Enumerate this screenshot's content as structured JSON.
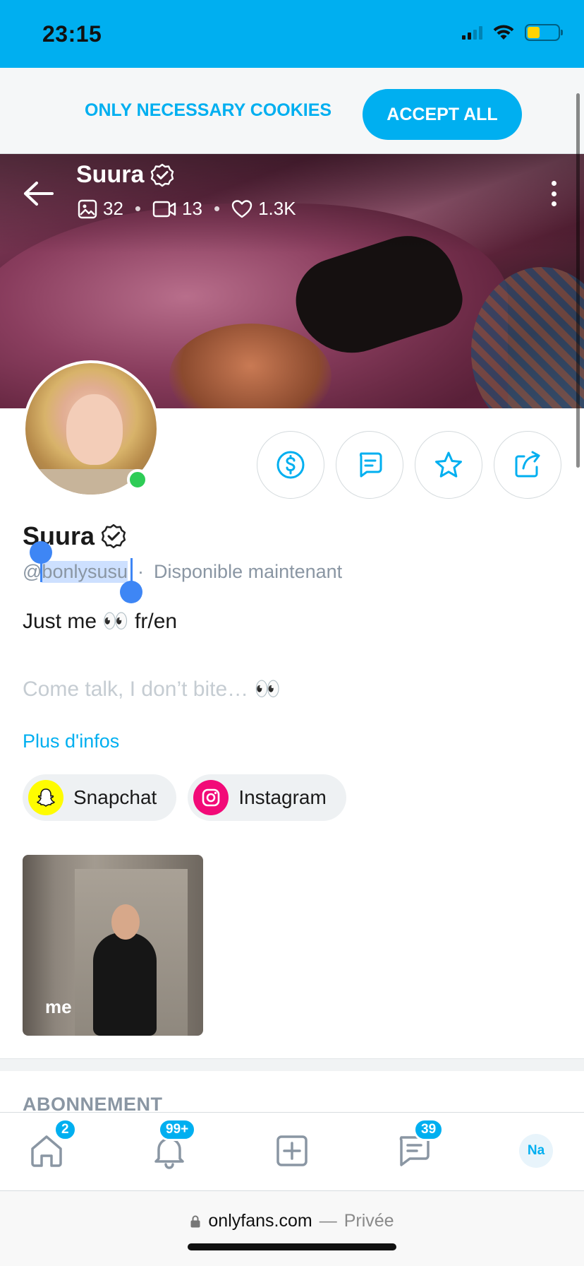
{
  "status_bar": {
    "time": "23:15"
  },
  "cookie_banner": {
    "necessary_label": "ONLY NECESSARY COOKIES",
    "accept_label": "ACCEPT ALL"
  },
  "header": {
    "name": "Suura",
    "photos_count": "32",
    "videos_count": "13",
    "likes_count": "1.3K"
  },
  "profile": {
    "name": "Suura",
    "handle_prefix": "@",
    "handle_selected": "bonlysusu",
    "separator": "·",
    "availability": "Disponible maintenant",
    "bio_line1": "Just me 👀 fr/en",
    "bio_line2": "Come talk, I don’t bite… 👀",
    "more_info": "Plus d'infos",
    "status_color": "#2ecc56"
  },
  "social_links": [
    {
      "label": "Snapchat",
      "icon": "snapchat-icon",
      "color": "#fffc00"
    },
    {
      "label": "Instagram",
      "icon": "instagram-icon",
      "color": "#f20a78"
    }
  ],
  "highlights": [
    {
      "label": "me"
    }
  ],
  "section": {
    "subscription_title": "ABONNEMENT"
  },
  "bottom_nav": {
    "home_badge": "2",
    "notifications_badge": "99+",
    "messages_badge": "39",
    "avatar_initials": "Na"
  },
  "browser": {
    "domain": "onlyfans.com",
    "dash": "—",
    "mode": "Privée"
  },
  "colors": {
    "accent": "#00aff0",
    "selection": "#3e86f5"
  }
}
